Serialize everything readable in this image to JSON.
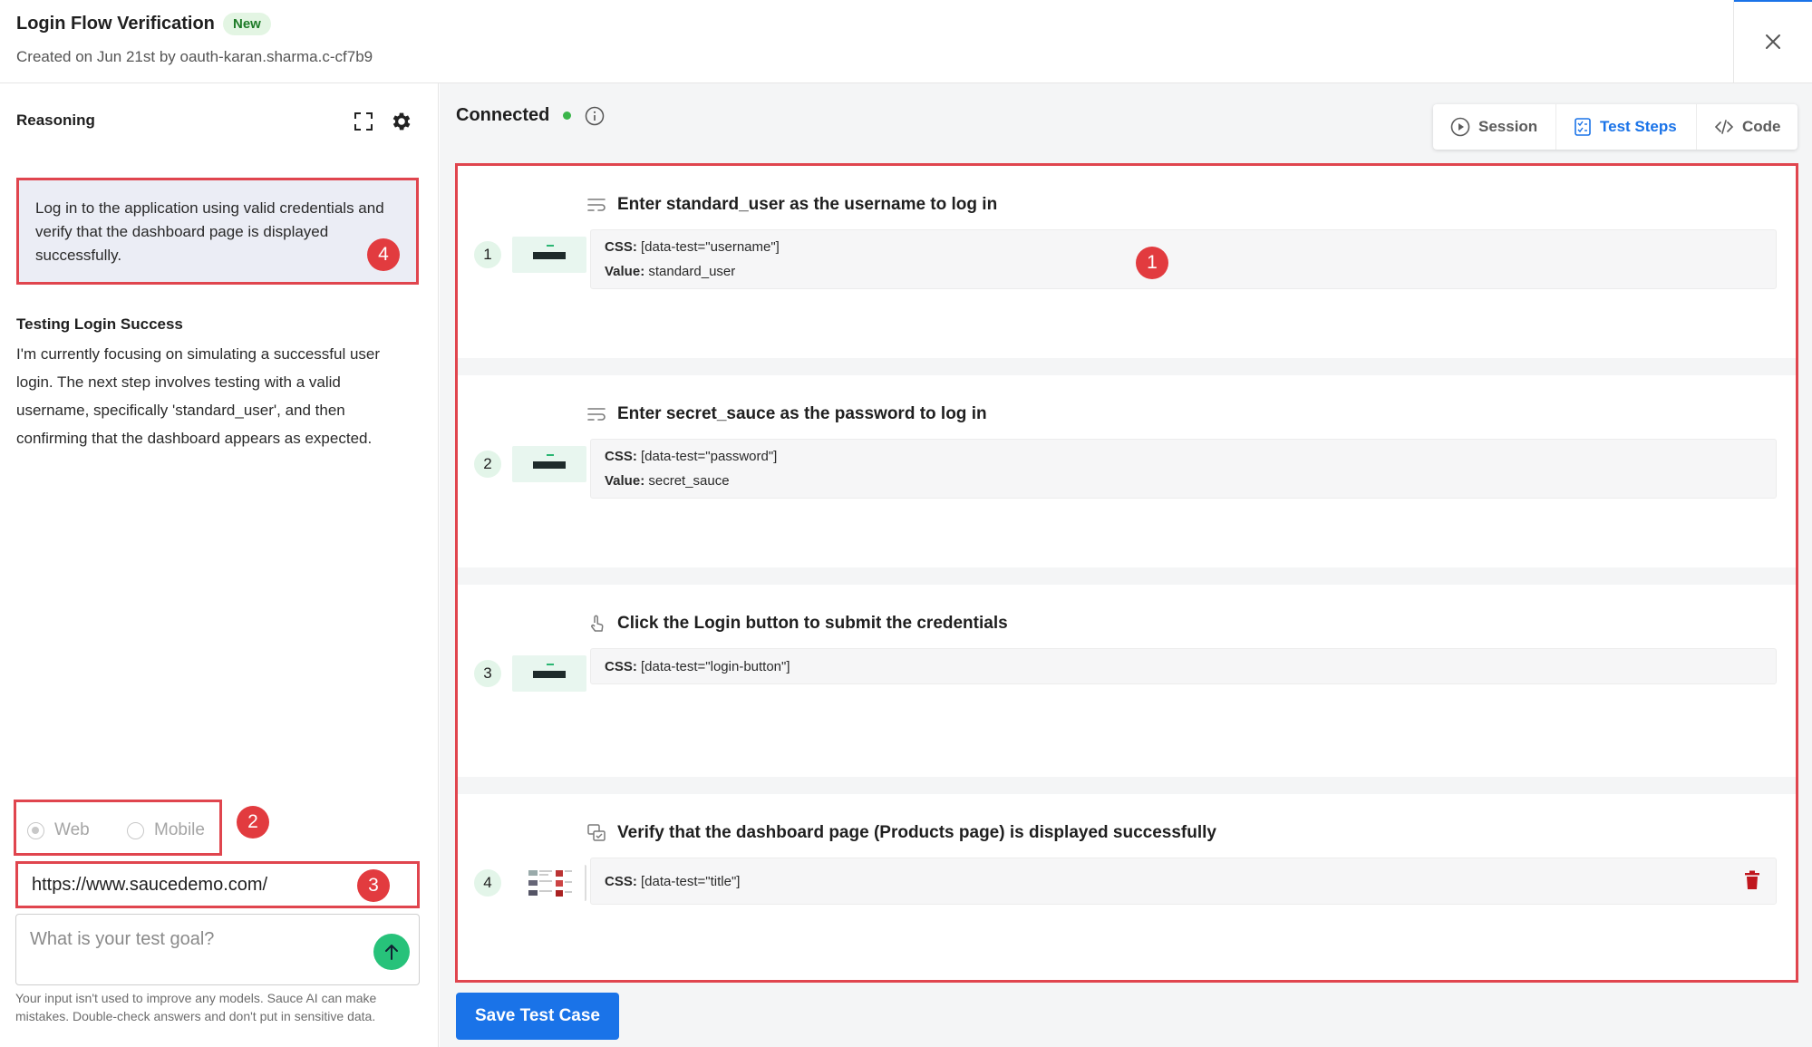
{
  "header": {
    "title": "Login Flow Verification",
    "badge": "New",
    "subtitle": "Created on Jun 21st by oauth-karan.sharma.c-cf7b9"
  },
  "left_panel": {
    "title": "Reasoning",
    "goal": "Log in to the application using valid credentials and verify that the dashboard page is displayed successfully.",
    "thinking_title": "Testing Login Success",
    "thinking_body": "I'm currently focusing on simulating a successful user login. The next step involves testing with a valid username, specifically 'standard_user', and then confirming that the dashboard appears as expected.",
    "platform_options": [
      "Web",
      "Mobile"
    ],
    "platform_selected": "Web",
    "url_value": "https://www.saucedemo.com/",
    "goal_placeholder": "What is your test goal?",
    "disclaimer": "Your input isn't used to improve any models. Sauce AI can make mistakes. Double-check answers and don't put in sensitive data."
  },
  "markers": [
    "1",
    "2",
    "3",
    "4"
  ],
  "right_panel": {
    "status": "Connected",
    "status_color": "#3ab54a",
    "tabs": [
      {
        "label": "Session",
        "icon": "play-circle-icon"
      },
      {
        "label": "Test Steps",
        "icon": "test-steps-icon",
        "active": true
      },
      {
        "label": "Code",
        "icon": "code-icon"
      }
    ],
    "steps": [
      {
        "num": "1",
        "icon": "type-text-icon",
        "title": "Enter standard_user as the username to log in",
        "css": "[data-test=\"username\"]",
        "value": "standard_user"
      },
      {
        "num": "2",
        "icon": "type-text-icon",
        "title": "Enter secret_sauce as the password to log in",
        "css": "[data-test=\"password\"]",
        "value": "secret_sauce"
      },
      {
        "num": "3",
        "icon": "tap-icon",
        "title": "Click the Login button to submit the credentials",
        "css": "[data-test=\"login-button\"]"
      },
      {
        "num": "4",
        "icon": "verify-image-icon",
        "title": "Verify that the dashboard page (Products page) is displayed successfully",
        "css": "[data-test=\"title\"]"
      }
    ],
    "css_label": "CSS:",
    "value_label": "Value:",
    "save_label": "Save Test Case"
  },
  "colors": {
    "accent": "#1a73e8",
    "highlight_border": "#e0454e",
    "marker": "#e23b3f",
    "send_button": "#27c27a",
    "delete": "#c0161d"
  }
}
